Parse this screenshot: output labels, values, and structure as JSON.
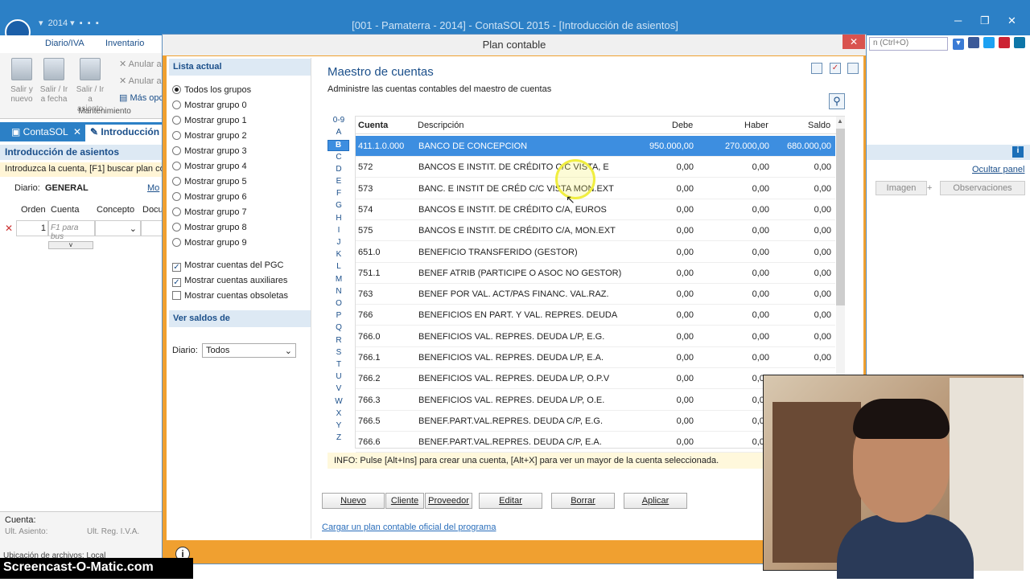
{
  "window": {
    "title": "[001 - Pamaterra - 2014] - ContaSOL 2015 - [Introducción de asientos]"
  },
  "ribbon": {
    "tabs": [
      "Diario/IVA",
      "Inventario"
    ],
    "buttons": [
      {
        "label": "Salir y nuevo"
      },
      {
        "label": "Salir / Ir a fecha"
      },
      {
        "label": "Salir / Ir a asiento"
      }
    ],
    "small": [
      "Anular a",
      "Anular a",
      "Más opc"
    ],
    "group": "Mantenimiento"
  },
  "doc_tabs": [
    "ContaSOL",
    "Introducción d"
  ],
  "left": {
    "panel_title": "Introducción de asientos",
    "message": "Introduzca la cuenta, [F1] buscar plan co",
    "diario_label": "Diario:",
    "diario_value": "GENERAL",
    "mo": "Mo",
    "columns": [
      "Orden",
      "Cuenta",
      "Concepto",
      "Docu"
    ],
    "row": {
      "orden": "1",
      "cuenta_placeholder": "F1 para bus"
    },
    "cuenta_label": "Cuenta:",
    "ult_asiento": "Ult. Asiento:",
    "ult_reg": "Ult. Reg. I.V.A.",
    "ubicacion": "Ubicación de archivos: Local"
  },
  "right": {
    "search_placeholder": "n (Ctrl+O)",
    "ocultar": "Ocultar panel",
    "imagen": "Imagen",
    "observaciones": "Observaciones"
  },
  "dialog": {
    "title": "Plan contable",
    "sidebar": {
      "lista_title": "Lista actual",
      "groups": [
        "Todos los grupos",
        "Mostrar grupo 0",
        "Mostrar grupo 1",
        "Mostrar grupo 2",
        "Mostrar grupo 3",
        "Mostrar grupo 4",
        "Mostrar grupo 5",
        "Mostrar grupo 6",
        "Mostrar grupo 7",
        "Mostrar grupo 8",
        "Mostrar grupo 9"
      ],
      "checks": [
        {
          "label": "Mostrar cuentas del PGC",
          "checked": true
        },
        {
          "label": "Mostrar cuentas auxiliares",
          "checked": true
        },
        {
          "label": "Mostrar cuentas obsoletas",
          "checked": false
        }
      ],
      "saldos_title": "Ver saldos de",
      "diario_label": "Diario:",
      "diario_value": "Todos"
    },
    "main": {
      "title": "Maestro de cuentas",
      "subtitle": "Administre las cuentas contables del maestro de cuentas",
      "letters": [
        "0-9",
        "A",
        "B",
        "C",
        "D",
        "E",
        "F",
        "G",
        "H",
        "I",
        "J",
        "K",
        "L",
        "M",
        "N",
        "O",
        "P",
        "Q",
        "R",
        "S",
        "T",
        "U",
        "V",
        "W",
        "X",
        "Y",
        "Z"
      ],
      "selected_letter": "B",
      "columns": [
        "Cuenta",
        "Descripción",
        "Debe",
        "Haber",
        "Saldo"
      ],
      "rows": [
        [
          "411.1.0.000",
          "BANCO DE CONCEPCION",
          "950.000,00",
          "270.000,00",
          "680.000,00"
        ],
        [
          "572",
          "BANCOS E INSTIT. DE CRÉDITO C/C VISTA, E",
          "0,00",
          "0,00",
          "0,00"
        ],
        [
          "573",
          "BANC. E INSTIT DE CRÉD C/C VISTA MON.EXT",
          "0,00",
          "0,00",
          "0,00"
        ],
        [
          "574",
          "BANCOS E INSTIT. DE CRÉDITO C/A, EUROS",
          "0,00",
          "0,00",
          "0,00"
        ],
        [
          "575",
          "BANCOS E INSTIT. DE CRÉDITO C/A, MON.EXT",
          "0,00",
          "0,00",
          "0,00"
        ],
        [
          "651.0",
          "BENEFICIO TRANSFERIDO (GESTOR)",
          "0,00",
          "0,00",
          "0,00"
        ],
        [
          "751.1",
          "BENEF ATRIB (PARTICIPE O ASOC NO GESTOR)",
          "0,00",
          "0,00",
          "0,00"
        ],
        [
          "763",
          "BENEF POR VAL. ACT/PAS  FINANC. VAL.RAZ.",
          "0,00",
          "0,00",
          "0,00"
        ],
        [
          "766",
          "BENEFICIOS EN PART. Y VAL. REPRES. DEUDA",
          "0,00",
          "0,00",
          "0,00"
        ],
        [
          "766.0",
          "BENEFICIOS VAL. REPRES. DEUDA L/P, E.G.",
          "0,00",
          "0,00",
          "0,00"
        ],
        [
          "766.1",
          "BENEFICIOS VAL. REPRES. DEUDA L/P, E.A.",
          "0,00",
          "0,00",
          "0,00"
        ],
        [
          "766.2",
          "BENEFICIOS VAL. REPRES. DEUDA L/P, O.P.V",
          "0,00",
          "0,00",
          "0,00"
        ],
        [
          "766.3",
          "BENEFICIOS VAL. REPRES. DEUDA L/P, O.E.",
          "0,00",
          "0,00",
          "0,00"
        ],
        [
          "766.5",
          "BENEF.PART.VAL.REPRES. DEUDA C/P, E.G.",
          "0,00",
          "0,00",
          "0,00"
        ],
        [
          "766.6",
          "BENEF.PART.VAL.REPRES. DEUDA C/P, E.A.",
          "0,00",
          "0,00",
          "0,0"
        ]
      ],
      "info": "INFO: Pulse [Alt+Ins] para crear una cuenta, [Alt+X] para ver un mayor de la cuenta seleccionada.",
      "buttons": [
        "Nuevo",
        "Cliente",
        "Proveedor",
        "Editar",
        "Borrar",
        "Aplicar"
      ],
      "link": "Cargar un plan contable oficial del programa"
    }
  },
  "watermark": "Screencast-O-Matic.com"
}
